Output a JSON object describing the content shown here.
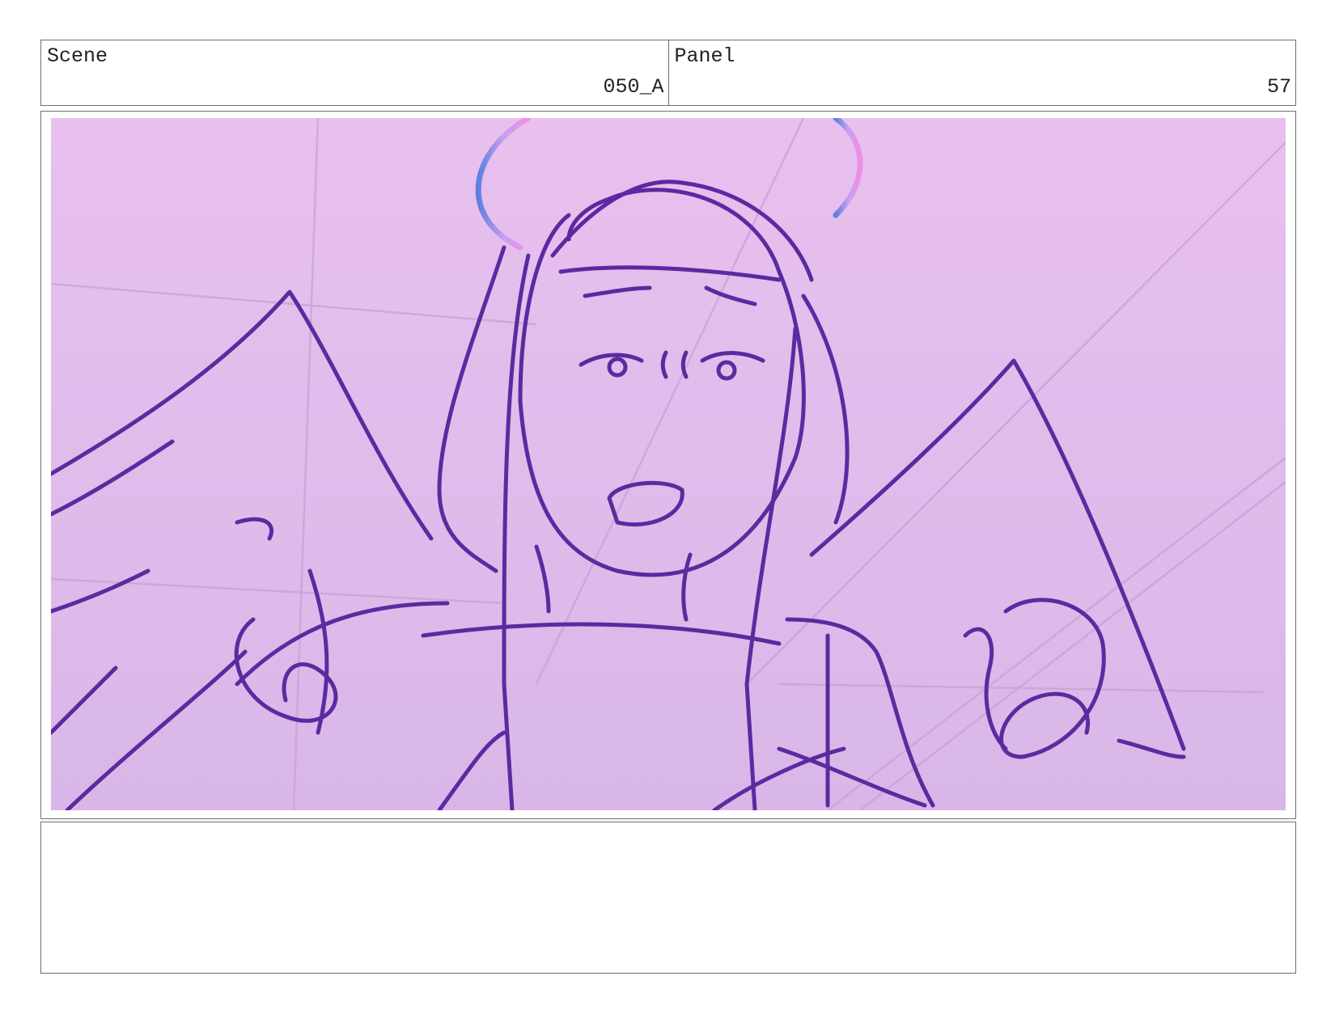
{
  "header": {
    "scene_label": "Scene",
    "scene_value": "050_A",
    "panel_label": "Panel",
    "panel_value": "57"
  },
  "frame": {
    "subject": "storyboard sketch",
    "colors": {
      "background_top": "#e8c0ee",
      "background_bottom": "#d8b7e8",
      "line": "#5b2aa0",
      "halo_a": "#5c7fe0",
      "halo_b": "#f08ee8"
    }
  },
  "notes": {
    "text": ""
  }
}
